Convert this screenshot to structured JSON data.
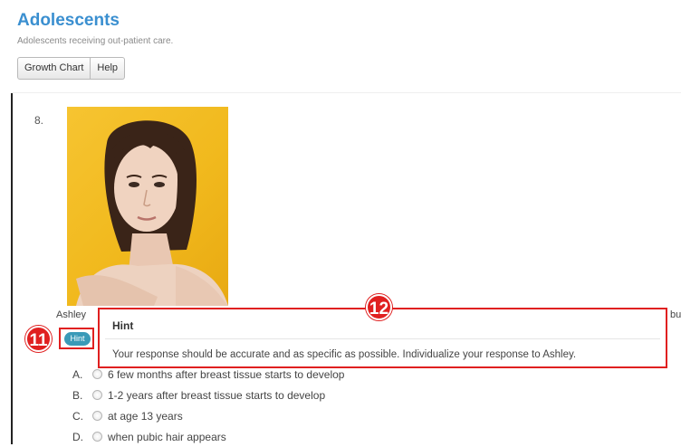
{
  "header": {
    "title": "Adolescents",
    "subtitle": "Adolescents receiving out-patient care."
  },
  "toolbar": {
    "growth_chart_label": "Growth Chart",
    "help_label": "Help"
  },
  "question": {
    "number": "8.",
    "stem_start": "Ashley",
    "stem_end": "bu",
    "hint_label": "Hint",
    "options": [
      {
        "letter": "A.",
        "text": "6 few months after breast tissue starts to develop"
      },
      {
        "letter": "B.",
        "text": "1-2 years after breast tissue starts to develop"
      },
      {
        "letter": "C.",
        "text": "at age 13 years"
      },
      {
        "letter": "D.",
        "text": "when pubic hair appears"
      }
    ]
  },
  "hint_popover": {
    "title": "Hint",
    "body": "Your response should be accurate and as specific as possible. Individualize your response to Ashley."
  },
  "annotations": {
    "badge_11": "11",
    "badge_12": "12"
  },
  "colors": {
    "title": "#3a8fd0",
    "hint_button": "#3a9ab8",
    "annotation": "#e02020",
    "photo_background": "#f6c431"
  }
}
